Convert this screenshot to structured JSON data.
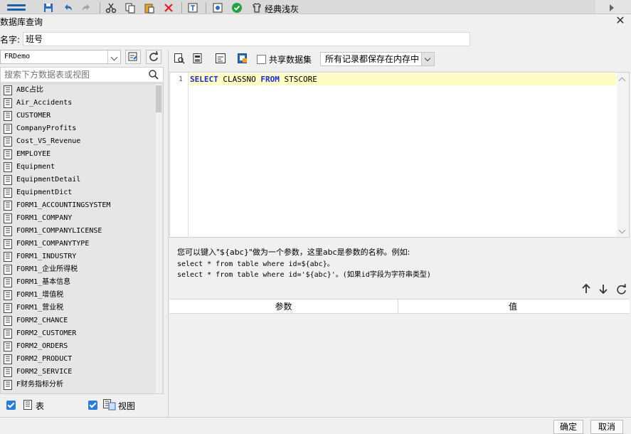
{
  "toolbar": {
    "theme_label": "经典浅灰",
    "icons": [
      "menu-icon",
      "save-icon",
      "undo-icon",
      "redo-icon",
      "cut-icon",
      "copy-icon",
      "paste-icon",
      "delete-icon",
      "preview-icon",
      "settings-icon",
      "check-icon",
      "theme-icon"
    ],
    "accent": "#1f5fa8"
  },
  "dialog": {
    "title": "数据库查询",
    "name_label": "名字:",
    "name_value": "班号"
  },
  "left": {
    "connection": "FRDemo",
    "search_placeholder": "搜索下方数据表或视图",
    "tables": [
      "ABC占比",
      "Air_Accidents",
      "CUSTOMER",
      "CompanyProfits",
      "Cost_VS_Revenue",
      "EMPLOYEE",
      "Equipment",
      "EquipmentDetail",
      "EquipmentDict",
      "FORM1_ACCOUNTINGSYSTEM",
      "FORM1_COMPANY",
      "FORM1_COMPANYLICENSE",
      "FORM1_COMPANYTYPE",
      "FORM1_INDUSTRY",
      "FORM1_企业所得税",
      "FORM1_基本信息",
      "FORM1_增值税",
      "FORM1_营业税",
      "FORM2_CHANCE",
      "FORM2_CUSTOMER",
      "FORM2_ORDERS",
      "FORM2_PRODUCT",
      "FORM2_SERVICE",
      "F财务指标分析"
    ],
    "filter_table_label": "表",
    "filter_view_label": "视图"
  },
  "editor": {
    "share_label": "共享数据集",
    "memory_option": "所有记录都保存在内存中",
    "line_number": "1",
    "sql": {
      "kw1": "SELECT",
      "field": " CLASSNO ",
      "kw2": "FROM",
      "table": " STSCORE"
    },
    "hint_line1": "您可以键入\"${abc}\"做为一个参数，这里abc是参数的名称。例如:",
    "hint_line2": "select * from table where id=${abc}。",
    "hint_line3": "select * from table where id='${abc}'。(如果id字段为字符串类型)"
  },
  "params": {
    "col_param": "参数",
    "col_value": "值"
  },
  "buttons": {
    "ok": "确定",
    "cancel": "取消"
  }
}
